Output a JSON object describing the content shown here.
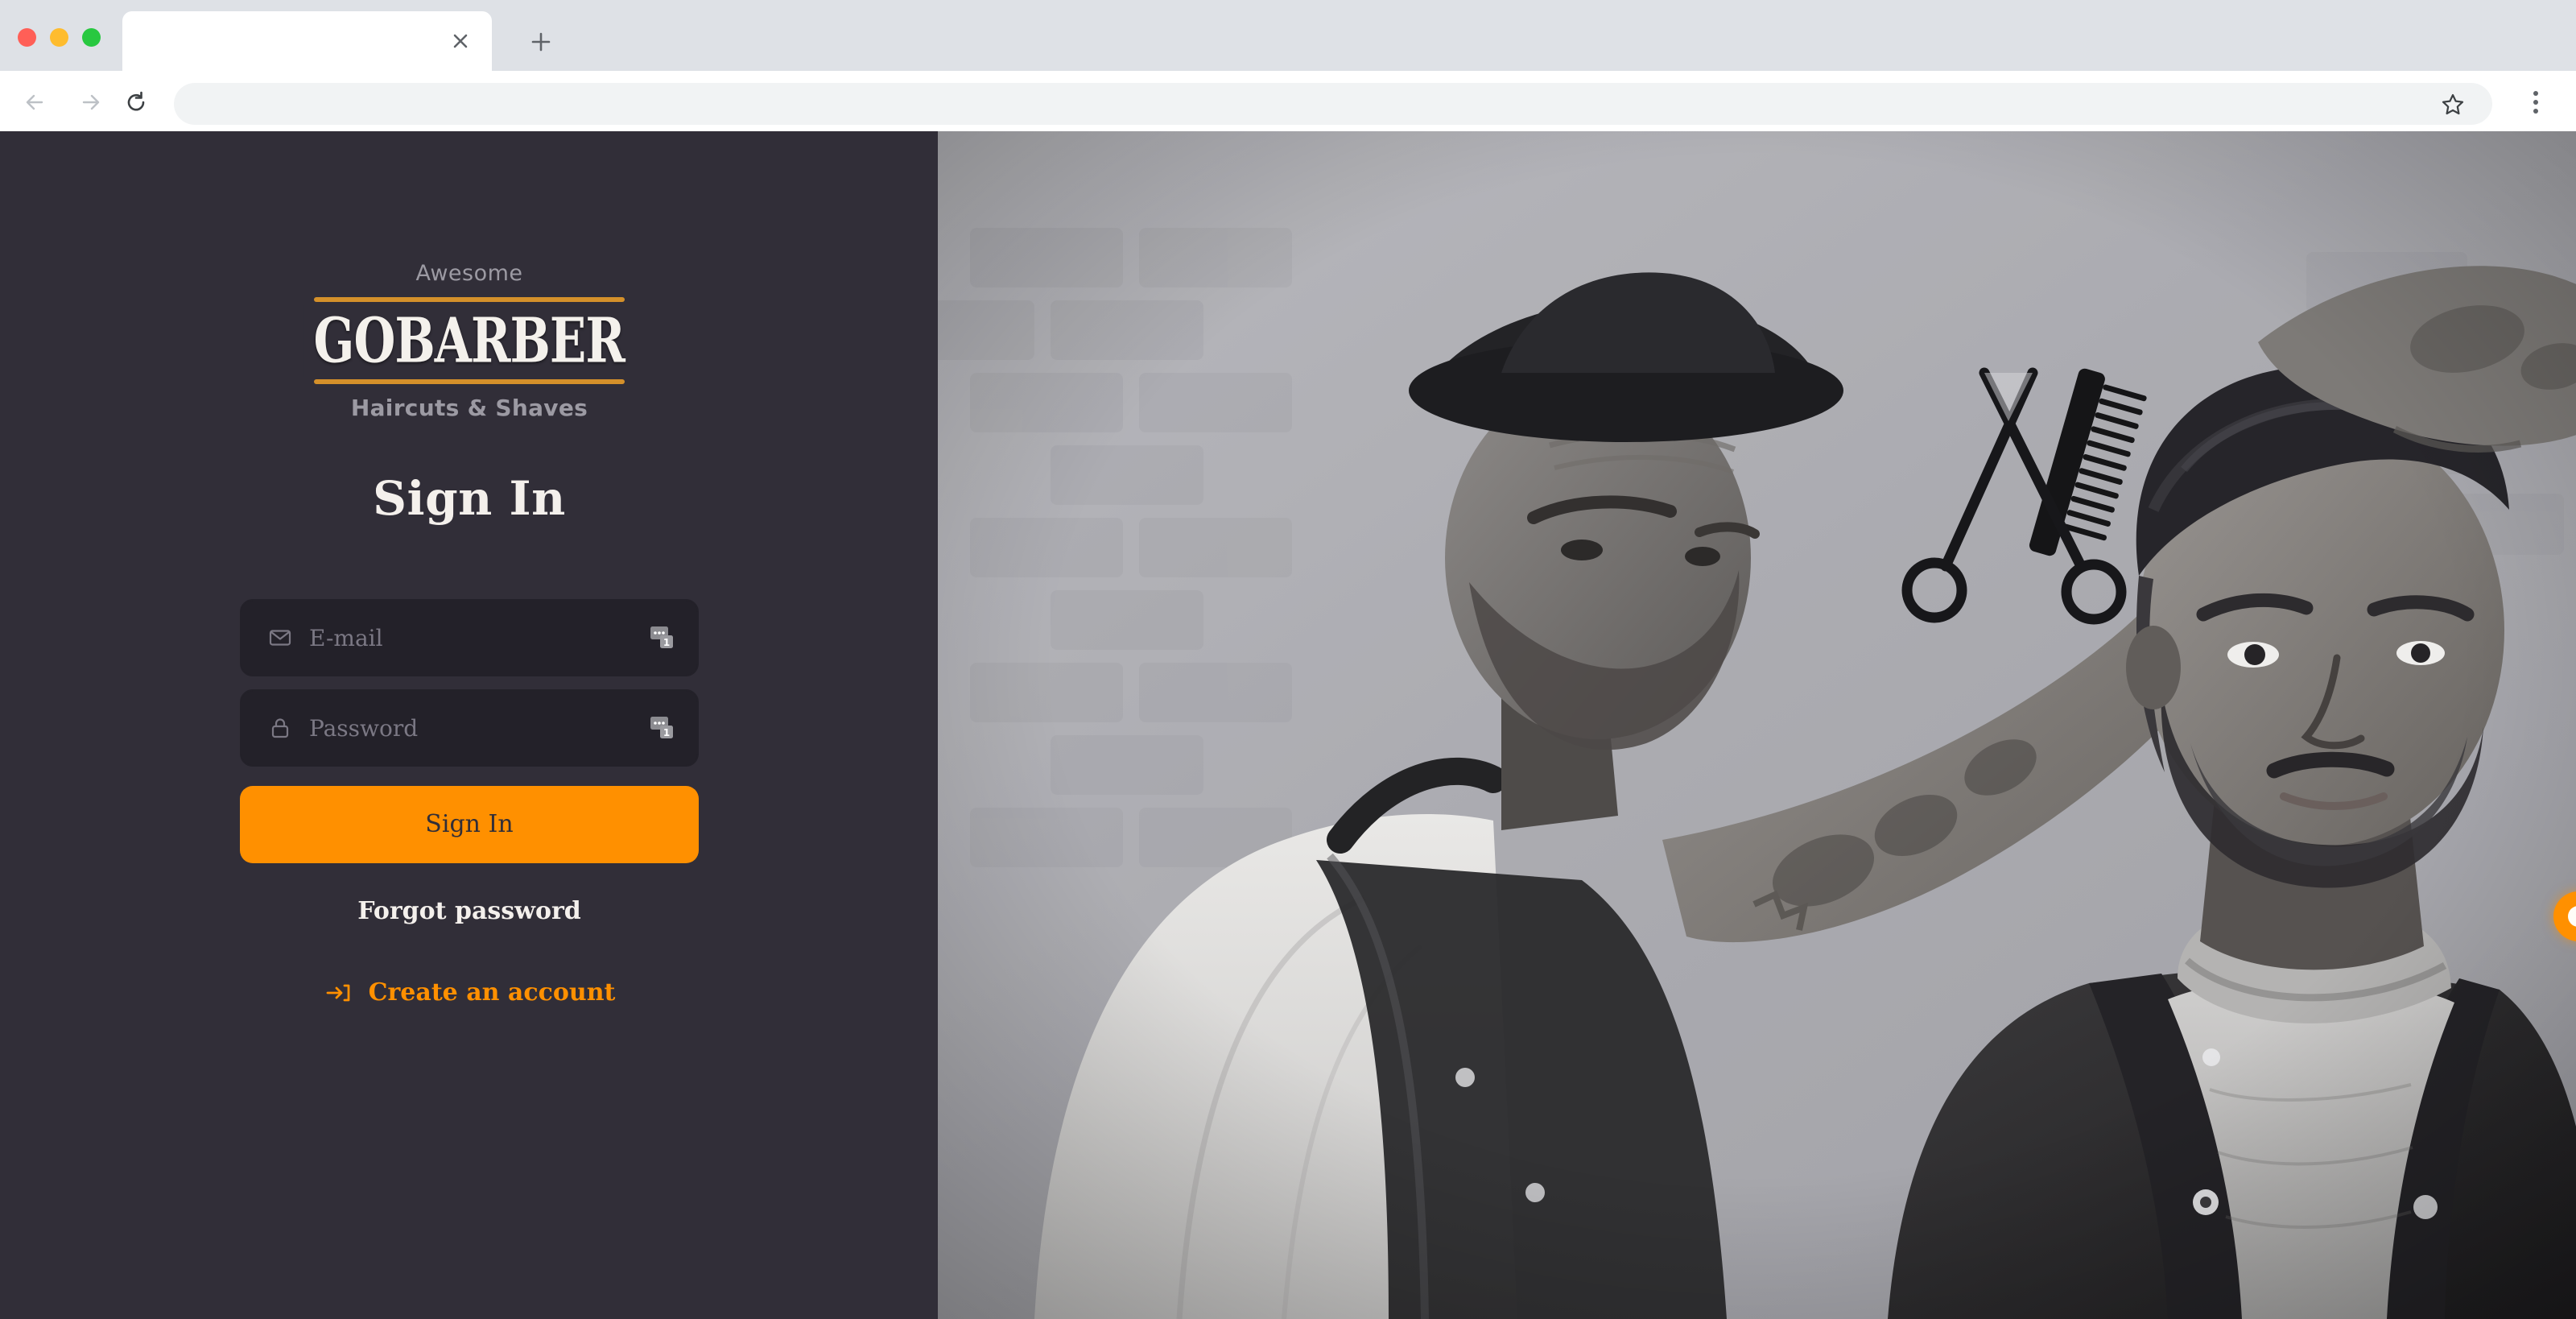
{
  "browser": {
    "tab": {
      "title": "",
      "close_label": "×"
    },
    "new_tab_label": "+",
    "nav": {
      "back_label": "Back",
      "forward_label": "Forward",
      "reload_label": "Reload"
    },
    "omnibox": {
      "value": "",
      "placeholder": ""
    },
    "bookmark_label": "Bookmark this tab",
    "menu_label": "Customize and control"
  },
  "auth": {
    "logo": {
      "top_word": "Awesome",
      "wordmark": "GOBARBER",
      "bottom_word": "Haircuts & Shaves"
    },
    "heading": "Sign In",
    "fields": [
      {
        "name": "email",
        "icon": "mail-icon",
        "placeholder": "E-mail",
        "value": "",
        "badge": "password-manager-badge",
        "badge_count": "1"
      },
      {
        "name": "password",
        "icon": "lock-icon",
        "placeholder": "Password",
        "value": "",
        "badge": "password-manager-badge",
        "badge_count": "1"
      }
    ],
    "submit_label": "Sign In",
    "forgot_label": "Forgot password",
    "create_account_label": "Create an account",
    "create_account_icon": "log-in-icon"
  },
  "colors": {
    "panel_bg": "#312e38",
    "input_bg": "#232129",
    "accent": "#ff9000",
    "rule": "#d4902a",
    "muted_text": "#9c9aa3",
    "light_text": "#f4f0ec",
    "chrome_tabstrip": "#dee1e6",
    "omnibox_bg": "#f1f3f4"
  },
  "hero": {
    "alt": "Barber cutting a seated client's hair with scissors and comb, black and white photo"
  },
  "chat_widget": {
    "label": "Open chat"
  }
}
